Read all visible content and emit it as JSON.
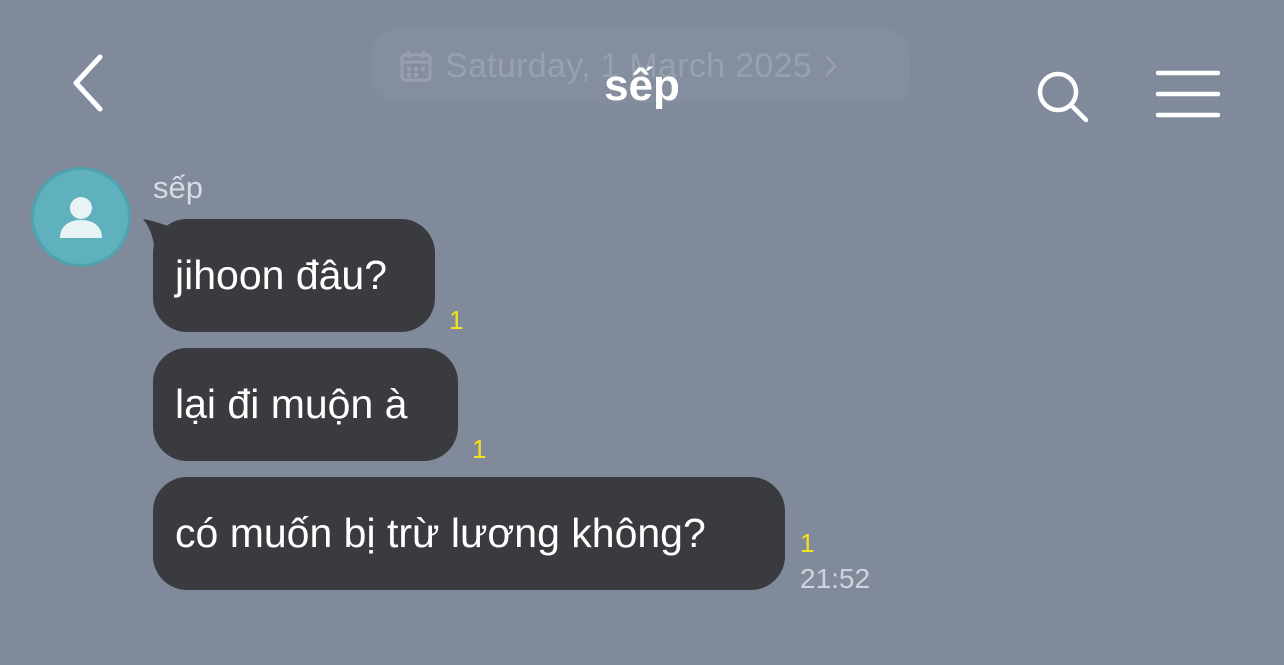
{
  "header": {
    "title": "sếp",
    "date_banner": "Saturday, 1 March 2025",
    "icons": {
      "back": "chevron-left-icon",
      "calendar": "calendar-icon",
      "date_chevron": "chevron-right-icon",
      "search": "search-icon",
      "menu": "hamburger-menu-icon"
    }
  },
  "conversation": {
    "sender": "sếp",
    "avatar_icon": "person-icon",
    "avatar_color": "#5eb1bd",
    "messages": [
      {
        "text": "jihoon đâu?",
        "unread": "1"
      },
      {
        "text": "lại đi muộn à",
        "unread": "1"
      },
      {
        "text": "có muốn bị trừ lương không?",
        "unread": "1",
        "time": "21:52"
      }
    ]
  },
  "colors": {
    "background": "#808a9b",
    "bubble": "#3a3b3f",
    "unread": "#f4e21b"
  }
}
